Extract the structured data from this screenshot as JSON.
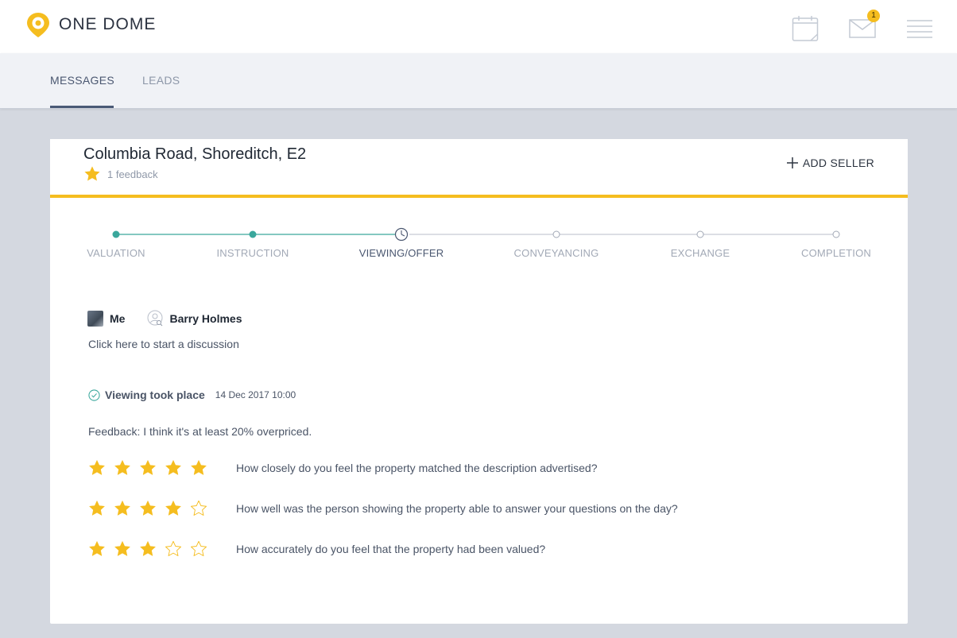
{
  "header": {
    "brand": "ONE DOME",
    "mail_badge_count": "1",
    "icons": [
      "calendar-icon",
      "mail-icon",
      "menu-icon"
    ],
    "brand_color": "#f5bd1f"
  },
  "tabs": [
    {
      "label": "MESSAGES",
      "active": true
    },
    {
      "label": "LEADS",
      "active": false
    }
  ],
  "property": {
    "title": "Columbia Road, Shoreditch, E2",
    "feedback_count": "1 feedback",
    "add_seller_label": "ADD SELLER"
  },
  "progress": {
    "steps": [
      {
        "label": "VALUATION",
        "state": "done"
      },
      {
        "label": "INSTRUCTION",
        "state": "done"
      },
      {
        "label": "VIEWING/OFFER",
        "state": "current"
      },
      {
        "label": "CONVEYANCING",
        "state": "pending"
      },
      {
        "label": "EXCHANGE",
        "state": "pending"
      },
      {
        "label": "COMPLETION",
        "state": "pending"
      }
    ],
    "done_color": "#3aa79c"
  },
  "participants": {
    "me": "Me",
    "other": "Barry Holmes",
    "discussion_prompt": "Click here to start a discussion"
  },
  "viewing": {
    "title": "Viewing took place",
    "date": "14 Dec 2017 10:00",
    "feedback": "Feedback: I think it's at least 20% overpriced."
  },
  "ratings": [
    {
      "stars": 5,
      "max": 5,
      "question": "How closely do you feel the property matched the description advertised?"
    },
    {
      "stars": 4,
      "max": 5,
      "question": "How well was the person showing the property able to answer your questions on the day?"
    },
    {
      "stars": 3,
      "max": 5,
      "question": "How accurately do you feel that the property had been valued?"
    }
  ]
}
